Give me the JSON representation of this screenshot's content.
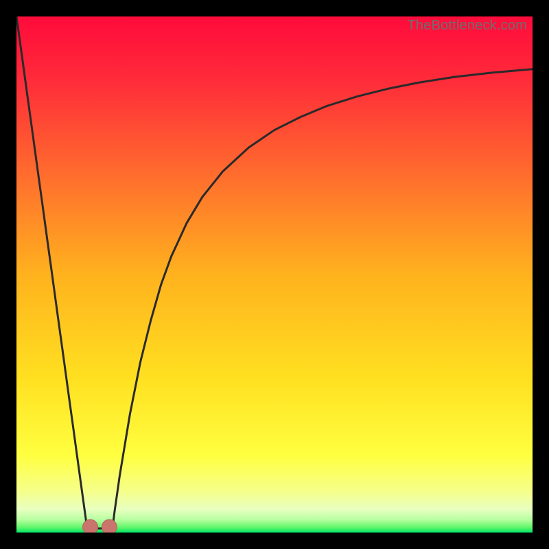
{
  "watermark": "TheBottleneck.com",
  "colors": {
    "gradient_stops": [
      {
        "offset": 0.0,
        "color": "#ff0b3b"
      },
      {
        "offset": 0.12,
        "color": "#ff2a3a"
      },
      {
        "offset": 0.3,
        "color": "#ff6a2e"
      },
      {
        "offset": 0.5,
        "color": "#ffb21e"
      },
      {
        "offset": 0.7,
        "color": "#ffe020"
      },
      {
        "offset": 0.85,
        "color": "#ffff40"
      },
      {
        "offset": 0.92,
        "color": "#f6ff8a"
      },
      {
        "offset": 0.955,
        "color": "#e8ffc0"
      },
      {
        "offset": 0.975,
        "color": "#b7ffa0"
      },
      {
        "offset": 0.99,
        "color": "#61f56a"
      },
      {
        "offset": 1.0,
        "color": "#00e765"
      }
    ],
    "curve": "#2a2a2a",
    "marker_fill": "#c9756e",
    "marker_stroke": "#b9635c",
    "frame": "#000000"
  },
  "chart_data": {
    "type": "line",
    "title": "",
    "xlabel": "",
    "ylabel": "",
    "xlim": [
      0,
      100
    ],
    "ylim": [
      0,
      100
    ],
    "grid": false,
    "series": [
      {
        "name": "left-branch",
        "x": [
          0,
          1,
          2,
          3,
          4,
          5,
          6,
          7,
          8,
          9,
          10,
          11,
          12,
          13,
          13.8
        ],
        "values": [
          100,
          92.8,
          85.5,
          78.3,
          71.0,
          63.8,
          56.5,
          49.3,
          42.0,
          34.8,
          27.5,
          20.3,
          13.0,
          5.8,
          0
        ]
      },
      {
        "name": "right-branch",
        "x": [
          18.5,
          19,
          20,
          22,
          24,
          26,
          28,
          30,
          33,
          36,
          40,
          45,
          50,
          55,
          60,
          66,
          72,
          78,
          85,
          92,
          100
        ],
        "values": [
          0,
          4,
          11,
          23,
          33,
          41,
          48,
          53.5,
          60,
          65,
          70,
          74.6,
          78,
          80.5,
          82.6,
          84.5,
          86,
          87.2,
          88.3,
          89.1,
          89.8
        ]
      }
    ],
    "flat_bottom": {
      "x": [
        13.8,
        18.5
      ],
      "y": 0
    },
    "markers": [
      {
        "x": 14.3,
        "y": 0.8
      },
      {
        "x": 18.0,
        "y": 0.8
      }
    ]
  }
}
